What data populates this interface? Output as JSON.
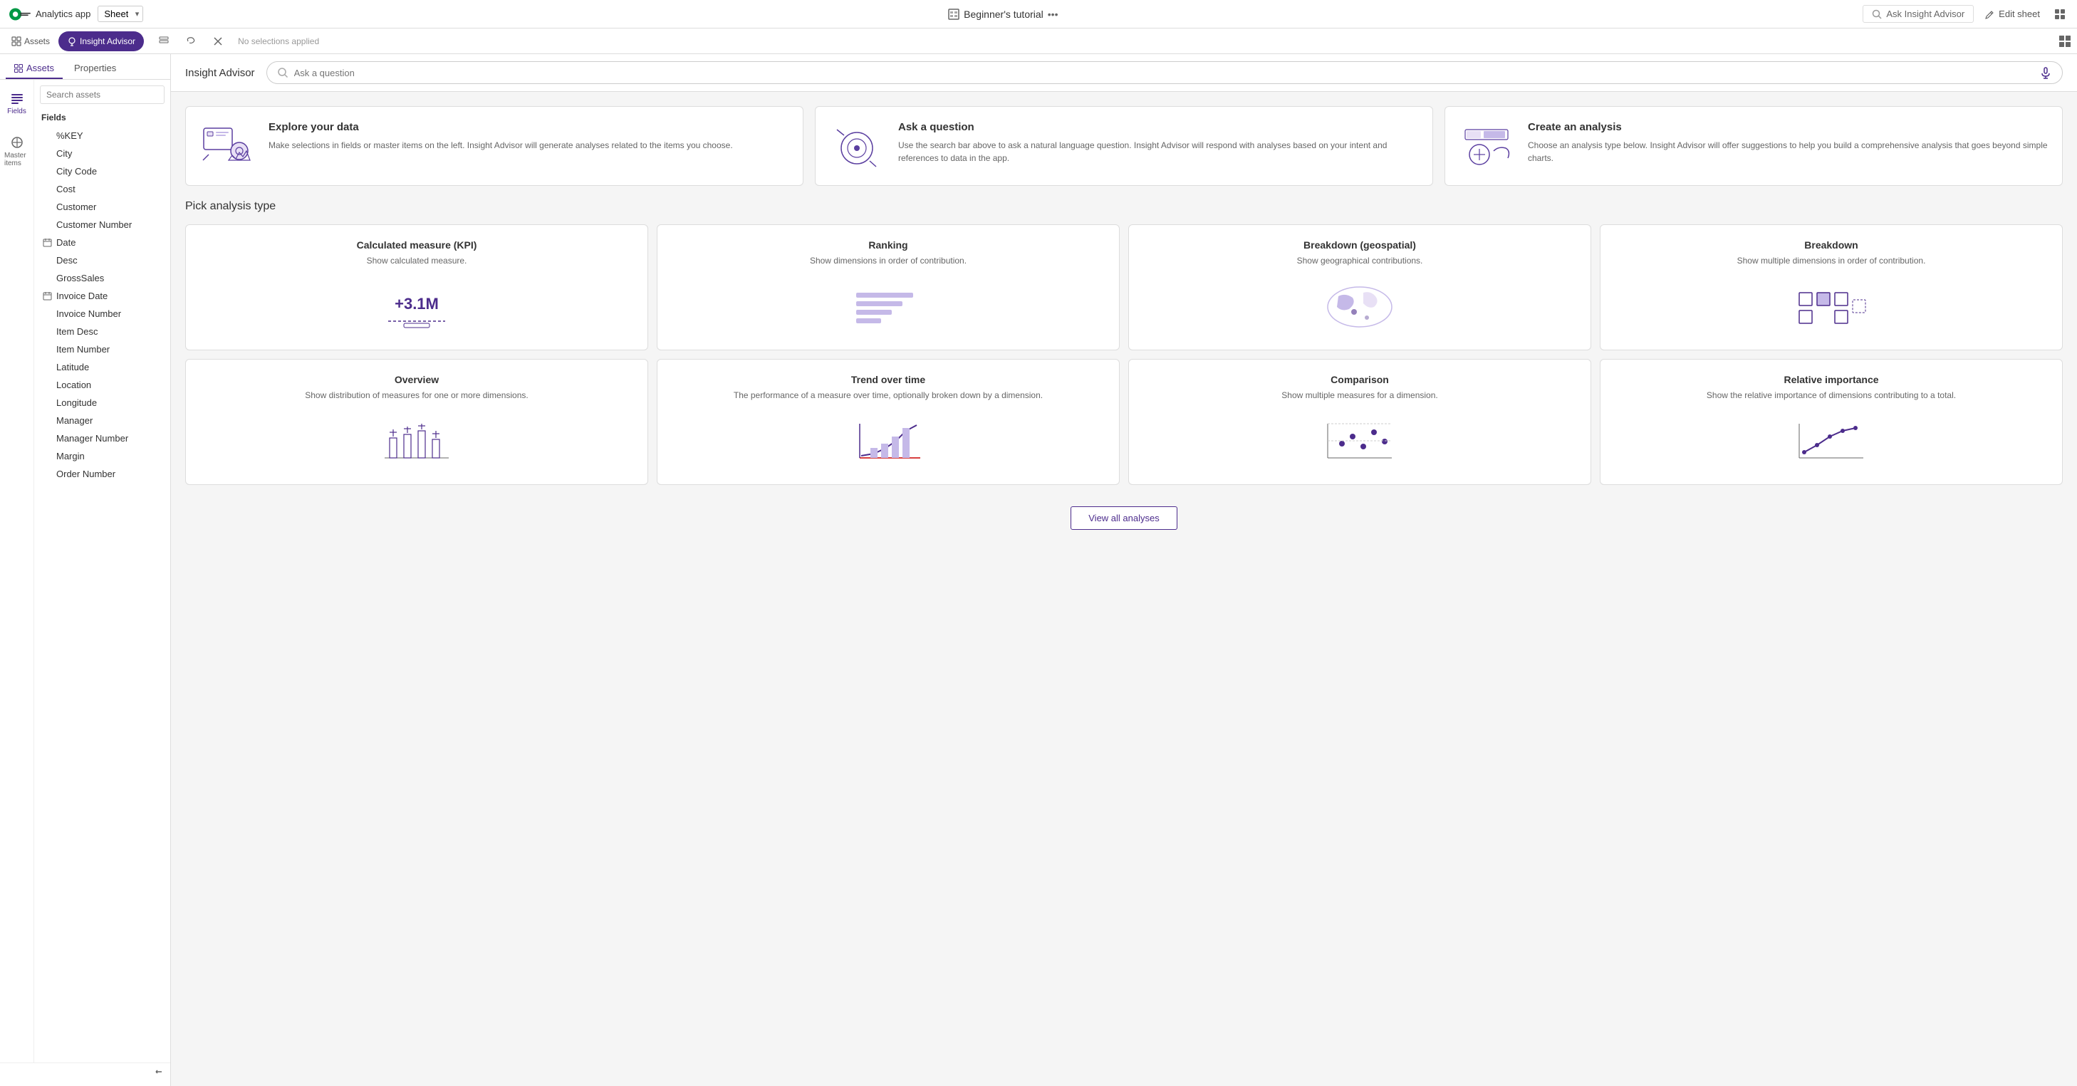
{
  "topbar": {
    "logo_text": "Analytics app",
    "sheet_selector": "Sheet",
    "app_name": "Beginner's tutorial",
    "ask_insight_label": "Ask Insight Advisor",
    "edit_sheet_label": "Edit sheet"
  },
  "toolbar": {
    "assets_label": "Assets",
    "insight_advisor_label": "Insight Advisor",
    "no_selections": "No selections applied"
  },
  "sidebar": {
    "assets_tab": "Assets",
    "properties_tab": "Properties",
    "search_placeholder": "Search assets",
    "fields_title": "Fields",
    "nav_items": [
      {
        "label": "Fields",
        "icon": "fields"
      },
      {
        "label": "Master items",
        "icon": "master"
      }
    ],
    "fields": [
      {
        "name": "%KEY",
        "type": "text"
      },
      {
        "name": "City",
        "type": "text"
      },
      {
        "name": "City Code",
        "type": "text"
      },
      {
        "name": "Cost",
        "type": "text"
      },
      {
        "name": "Customer",
        "type": "text"
      },
      {
        "name": "Customer Number",
        "type": "text"
      },
      {
        "name": "Date",
        "type": "calendar"
      },
      {
        "name": "Desc",
        "type": "text"
      },
      {
        "name": "GrossSales",
        "type": "text"
      },
      {
        "name": "Invoice Date",
        "type": "calendar"
      },
      {
        "name": "Invoice Number",
        "type": "text"
      },
      {
        "name": "Item Desc",
        "type": "text"
      },
      {
        "name": "Item Number",
        "type": "text"
      },
      {
        "name": "Latitude",
        "type": "text"
      },
      {
        "name": "Location",
        "type": "text"
      },
      {
        "name": "Longitude",
        "type": "text"
      },
      {
        "name": "Manager",
        "type": "text"
      },
      {
        "name": "Manager Number",
        "type": "text"
      },
      {
        "name": "Margin",
        "type": "text"
      },
      {
        "name": "Order Number",
        "type": "text"
      }
    ]
  },
  "insight_advisor": {
    "title": "Insight Advisor",
    "search_placeholder": "Ask a question"
  },
  "intro_cards": [
    {
      "id": "explore",
      "title": "Explore your data",
      "description": "Make selections in fields or master items on the left. Insight Advisor will generate analyses related to the items you choose."
    },
    {
      "id": "ask",
      "title": "Ask a question",
      "description": "Use the search bar above to ask a natural language question. Insight Advisor will respond with analyses based on your intent and references to data in the app."
    },
    {
      "id": "create",
      "title": "Create an analysis",
      "description": "Choose an analysis type below. Insight Advisor will offer suggestions to help you build a comprehensive analysis that goes beyond simple charts."
    }
  ],
  "analysis_section": {
    "title": "Pick analysis type",
    "view_all_label": "View all analyses",
    "types": [
      {
        "id": "kpi",
        "title": "Calculated measure (KPI)",
        "description": "Show calculated measure.",
        "sample": "kpi"
      },
      {
        "id": "ranking",
        "title": "Ranking",
        "description": "Show dimensions in order of contribution.",
        "sample": "ranking"
      },
      {
        "id": "breakdown-geo",
        "title": "Breakdown (geospatial)",
        "description": "Show geographical contributions.",
        "sample": "geo"
      },
      {
        "id": "breakdown",
        "title": "Breakdown",
        "description": "Show multiple dimensions in order of contribution.",
        "sample": "breakdown"
      },
      {
        "id": "overview",
        "title": "Overview",
        "description": "Show distribution of measures for one or more dimensions.",
        "sample": "overview"
      },
      {
        "id": "trend",
        "title": "Trend over time",
        "description": "The performance of a measure over time, optionally broken down by a dimension.",
        "sample": "trend"
      },
      {
        "id": "comparison",
        "title": "Comparison",
        "description": "Show multiple measures for a dimension.",
        "sample": "comparison"
      },
      {
        "id": "relative",
        "title": "Relative importance",
        "description": "Show the relative importance of dimensions contributing to a total.",
        "sample": "relative"
      }
    ]
  }
}
